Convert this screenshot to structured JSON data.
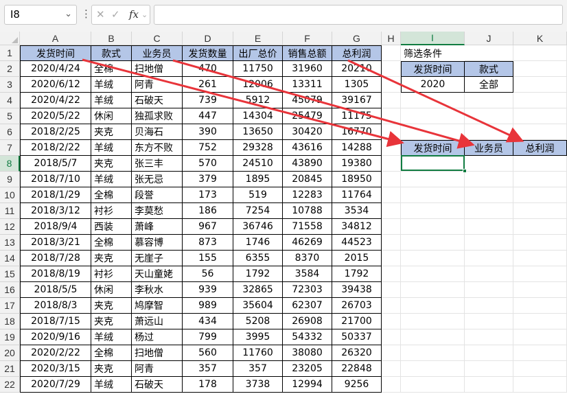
{
  "formula_bar": {
    "name_box": "I8",
    "name_box_arrow": "⌄",
    "more_icon": "⋮",
    "cancel_icon": "✕",
    "enter_icon": "✓",
    "fx_label": "fx",
    "fx_arrow": "⌄",
    "formula": ""
  },
  "columns": [
    "A",
    "B",
    "C",
    "D",
    "E",
    "F",
    "G",
    "H",
    "I",
    "J",
    "K"
  ],
  "rows": [
    "1",
    "2",
    "3",
    "4",
    "5",
    "6",
    "7",
    "8",
    "9",
    "10",
    "11",
    "12",
    "13",
    "14",
    "15",
    "16",
    "17",
    "18",
    "19",
    "20",
    "21",
    "22"
  ],
  "table": {
    "headers": [
      "发货时间",
      "款式",
      "业务员",
      "发货数量",
      "出厂总价",
      "销售总额",
      "总利润"
    ],
    "rows": [
      [
        "2020/4/24",
        "全棉",
        "扫地僧",
        "470",
        "11750",
        "31960",
        "20210"
      ],
      [
        "2020/6/12",
        "羊绒",
        "阿青",
        "261",
        "12006",
        "13311",
        "1305"
      ],
      [
        "2020/4/22",
        "羊绒",
        "石破天",
        "739",
        "5912",
        "45079",
        "39167"
      ],
      [
        "2020/5/22",
        "休闲",
        "独孤求败",
        "447",
        "14304",
        "25479",
        "11175"
      ],
      [
        "2018/2/25",
        "夹克",
        "贝海石",
        "390",
        "13650",
        "30420",
        "16770"
      ],
      [
        "2018/2/22",
        "羊绒",
        "东方不败",
        "752",
        "29328",
        "43616",
        "14288"
      ],
      [
        "2018/5/7",
        "夹克",
        "张三丰",
        "570",
        "24510",
        "43890",
        "19380"
      ],
      [
        "2018/7/10",
        "羊绒",
        "张无忌",
        "379",
        "1895",
        "20845",
        "18950"
      ],
      [
        "2018/1/29",
        "全棉",
        "段誉",
        "173",
        "519",
        "12283",
        "11764"
      ],
      [
        "2018/3/12",
        "衬衫",
        "李莫愁",
        "186",
        "7254",
        "10788",
        "3534"
      ],
      [
        "2018/9/4",
        "西装",
        "萧峰",
        "967",
        "36746",
        "71558",
        "34812"
      ],
      [
        "2018/3/21",
        "全棉",
        "慕容博",
        "873",
        "1746",
        "46269",
        "44523"
      ],
      [
        "2018/7/28",
        "夹克",
        "无崖子",
        "155",
        "6355",
        "8370",
        "2015"
      ],
      [
        "2018/8/19",
        "衬衫",
        "天山童姥",
        "56",
        "1792",
        "3584",
        "1792"
      ],
      [
        "2018/5/5",
        "休闲",
        "李秋水",
        "939",
        "32865",
        "72303",
        "39438"
      ],
      [
        "2018/8/3",
        "夹克",
        "鸠摩智",
        "989",
        "35604",
        "62307",
        "26703"
      ],
      [
        "2018/7/15",
        "夹克",
        "萧远山",
        "434",
        "5208",
        "26908",
        "21700"
      ],
      [
        "2020/9/16",
        "羊绒",
        "杨过",
        "799",
        "3995",
        "54332",
        "50337"
      ],
      [
        "2020/2/22",
        "全棉",
        "扫地僧",
        "560",
        "11760",
        "38080",
        "26320"
      ],
      [
        "2020/3/15",
        "夹克",
        "阿青",
        "357",
        "357",
        "23205",
        "22848"
      ],
      [
        "2020/7/29",
        "羊绒",
        "石破天",
        "178",
        "3738",
        "12994",
        "9256"
      ]
    ]
  },
  "criteria": {
    "title": "筛选条件",
    "headers": [
      "发货时间",
      "款式"
    ],
    "values": [
      "2020",
      "全部"
    ]
  },
  "output": {
    "headers": [
      "发货时间",
      "业务员",
      "总利润"
    ]
  },
  "colors": {
    "header_fill": "#b4c6e7",
    "arrow": "#e8343a",
    "selection": "#107c41"
  }
}
